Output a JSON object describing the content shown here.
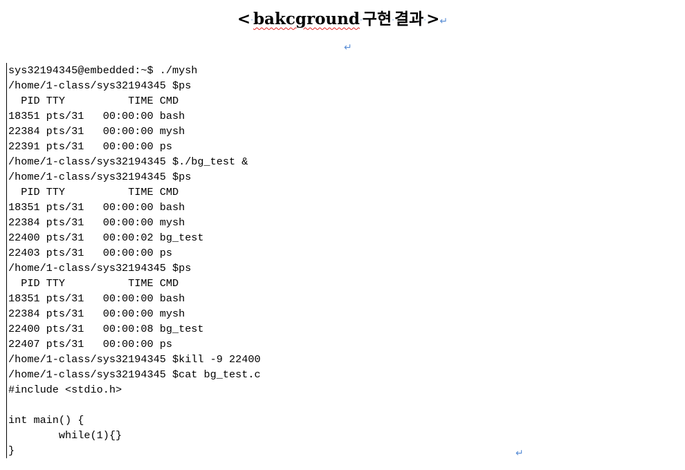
{
  "document": {
    "heading_open": "<",
    "heading_word": "bakcground",
    "heading_rest_1": "구현",
    "heading_rest_2": "결과",
    "heading_close": ">",
    "paragraph_mark": "↵",
    "space_mark": "·"
  },
  "terminal": {
    "lines": [
      "sys32194345@embedded:~$ ./mysh",
      "/home/1-class/sys32194345 $ps",
      "  PID TTY          TIME CMD",
      "18351 pts/31   00:00:00 bash",
      "22384 pts/31   00:00:00 mysh",
      "22391 pts/31   00:00:00 ps",
      "/home/1-class/sys32194345 $./bg_test &",
      "/home/1-class/sys32194345 $ps",
      "  PID TTY          TIME CMD",
      "18351 pts/31   00:00:00 bash",
      "22384 pts/31   00:00:00 mysh",
      "22400 pts/31   00:00:02 bg_test",
      "22403 pts/31   00:00:00 ps",
      "/home/1-class/sys32194345 $ps",
      "  PID TTY          TIME CMD",
      "18351 pts/31   00:00:00 bash",
      "22384 pts/31   00:00:00 mysh",
      "22400 pts/31   00:00:08 bg_test",
      "22407 pts/31   00:00:00 ps",
      "/home/1-class/sys32194345 $kill -9 22400",
      "/home/1-class/sys32194345 $cat bg_test.c",
      "#include <stdio.h>",
      "",
      "int main() {",
      "        while(1){}",
      "}"
    ]
  }
}
